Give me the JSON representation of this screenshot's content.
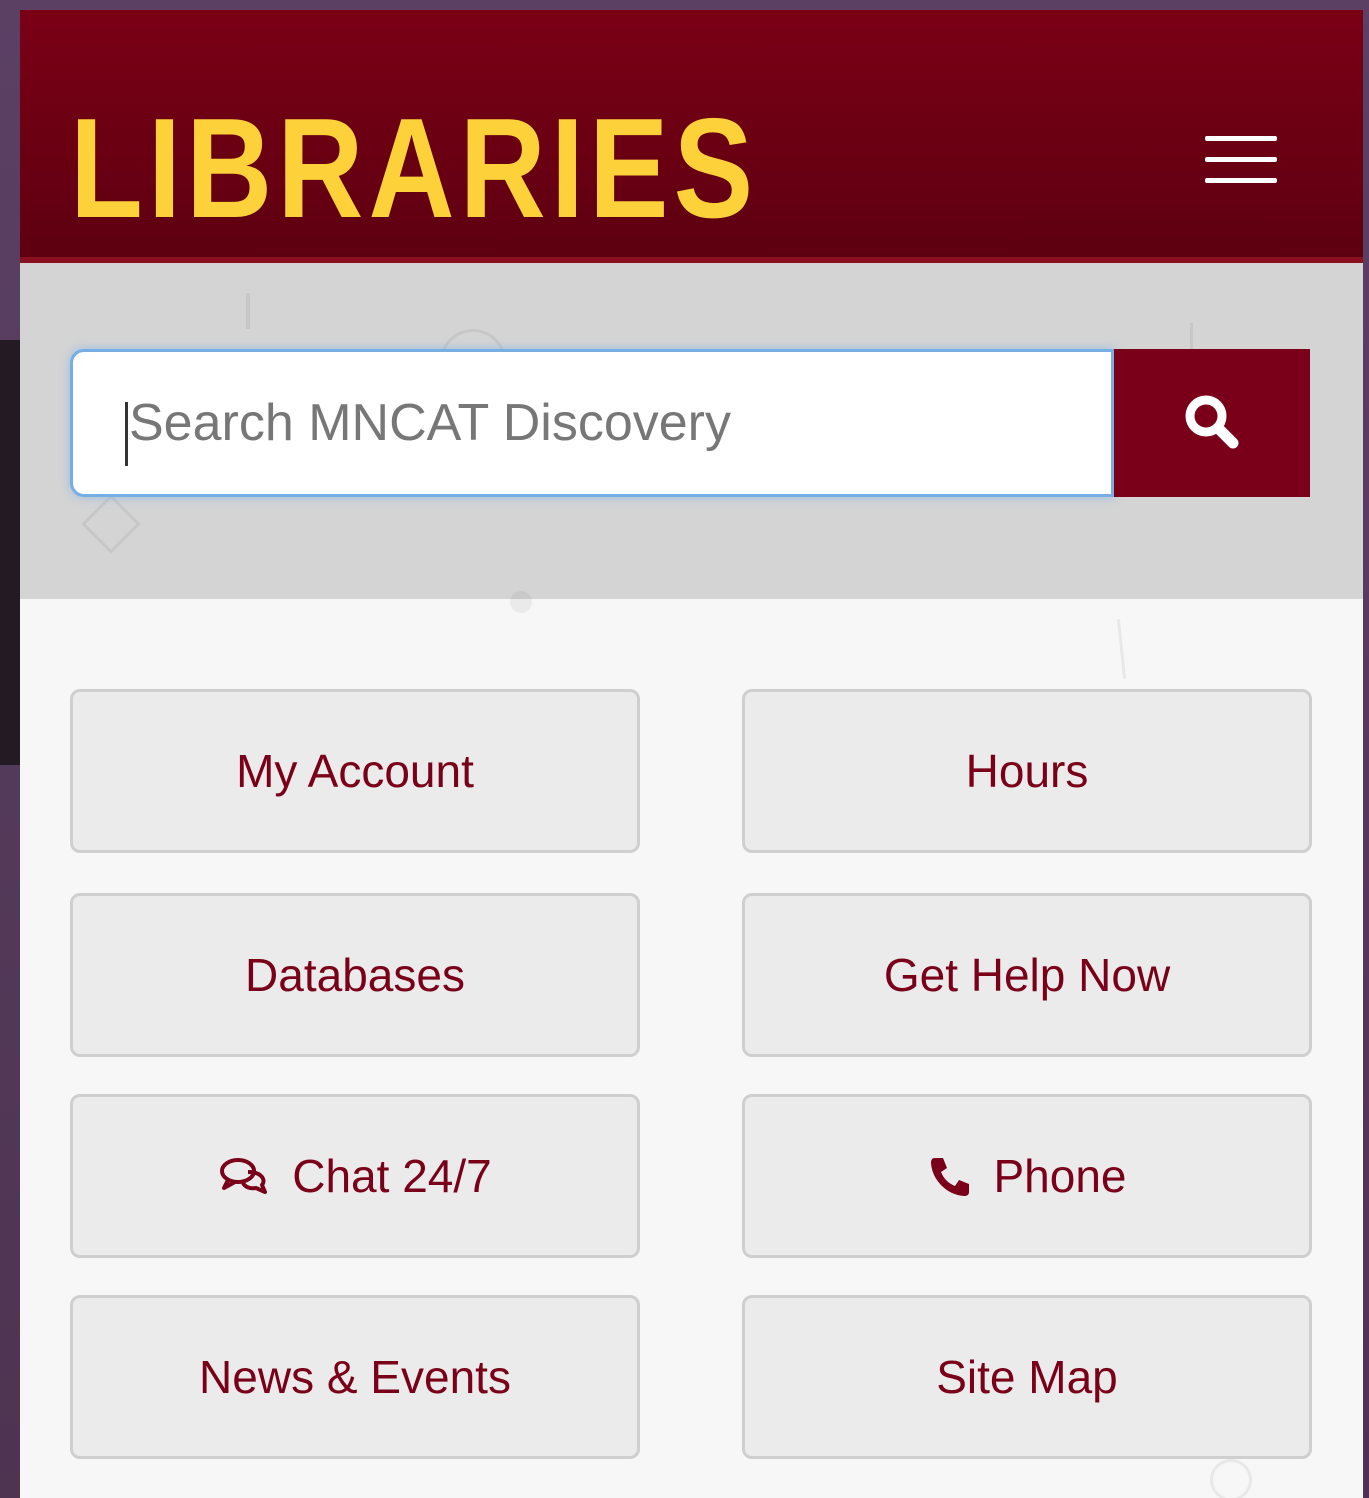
{
  "header": {
    "logo_text": "LIBRARIES",
    "menu_icon": "hamburger-menu-icon"
  },
  "search": {
    "placeholder": "Search MNCAT Discovery",
    "button_icon": "search-icon"
  },
  "quick_links": [
    {
      "label": "My Account"
    },
    {
      "label": "Hours"
    },
    {
      "label": "Databases"
    },
    {
      "label": "Get Help Now"
    },
    {
      "label": "Chat 24/7",
      "icon": "chat-icon"
    },
    {
      "label": "Phone",
      "icon": "phone-icon"
    },
    {
      "label": "News & Events"
    },
    {
      "label": "Site Map"
    }
  ],
  "colors": {
    "maroon": "#7a0019",
    "gold": "#fdd13a",
    "search_band": "#d4d4d4",
    "tile_background": "#ebebeb",
    "focus_ring": "#77aee6"
  }
}
